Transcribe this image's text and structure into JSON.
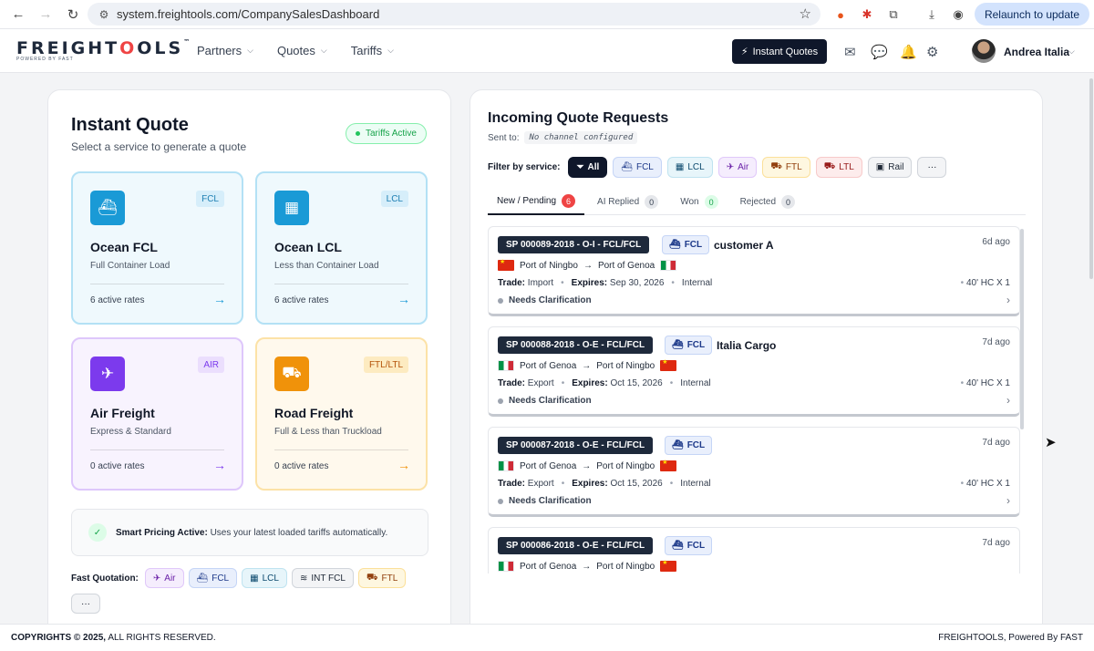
{
  "browser": {
    "url": "system.freightools.com/CompanySalesDashboard",
    "relaunch_label": "Relaunch to update"
  },
  "header": {
    "logo_text": "FREIGHTOOLS",
    "logo_tm": "™",
    "logo_sub": "POWERED BY FAST",
    "nav": [
      "Partners",
      "Quotes",
      "Tariffs"
    ],
    "instant_quotes_label": "Instant Quotes",
    "user_name": "Andrea Italia"
  },
  "instant_quote": {
    "title": "Instant Quote",
    "subtitle": "Select a service to generate a quote",
    "status_badge": "Tariffs Active",
    "services": [
      {
        "name": "Ocean FCL",
        "tag": "FCL",
        "desc": "Full Container Load",
        "rates": "6 active rates"
      },
      {
        "name": "Ocean LCL",
        "tag": "LCL",
        "desc": "Less than Container Load",
        "rates": "6 active rates"
      },
      {
        "name": "Air Freight",
        "tag": "AIR",
        "desc": "Express & Standard",
        "rates": "0 active rates"
      },
      {
        "name": "Road Freight",
        "tag": "FTL/LTL",
        "desc": "Full & Less than Truckload",
        "rates": "0 active rates"
      }
    ],
    "smart_pricing_title": "Smart Pricing Active:",
    "smart_pricing_text": "Uses your latest loaded tariffs automatically.",
    "fast_quotation_label": "Fast Quotation:",
    "fast_chips": [
      "Air",
      "FCL",
      "LCL",
      "INT FCL",
      "FTL"
    ],
    "more_label": "···"
  },
  "requests": {
    "title": "Incoming Quote Requests",
    "sent_to_label": "Sent to:",
    "sent_to_value": "No channel configured",
    "filter_label": "Filter by service:",
    "filters": [
      "All",
      "FCL",
      "LCL",
      "Air",
      "FTL",
      "LTL",
      "Rail"
    ],
    "filter_more": "···",
    "tabs": [
      {
        "label": "New / Pending",
        "count": "6"
      },
      {
        "label": "AI Replied",
        "count": "0"
      },
      {
        "label": "Won",
        "count": "0"
      },
      {
        "label": "Rejected",
        "count": "0"
      }
    ],
    "items": [
      {
        "ref": "SP 000089-2018 - O-I - FCL/FCL",
        "mode": "FCL",
        "customer": "customer A",
        "ago": "6d ago",
        "from": "Port of Ningbo",
        "to": "Port of Genoa",
        "trade_label": "Trade:",
        "trade": "Import",
        "expires_label": "Expires:",
        "expires": "Sep 30, 2026",
        "scope": "Internal",
        "container": "40' HC X 1",
        "status": "Needs Clarification"
      },
      {
        "ref": "SP 000088-2018 - O-E - FCL/FCL",
        "mode": "FCL",
        "customer": "Italia Cargo",
        "ago": "7d ago",
        "from": "Port of Genoa",
        "to": "Port of Ningbo",
        "trade_label": "Trade:",
        "trade": "Export",
        "expires_label": "Expires:",
        "expires": "Oct 15, 2026",
        "scope": "Internal",
        "container": "40' HC X 1",
        "status": "Needs Clarification"
      },
      {
        "ref": "SP 000087-2018 - O-E - FCL/FCL",
        "mode": "FCL",
        "customer": "",
        "ago": "7d ago",
        "from": "Port of Genoa",
        "to": "Port of Ningbo",
        "trade_label": "Trade:",
        "trade": "Export",
        "expires_label": "Expires:",
        "expires": "Oct 15, 2026",
        "scope": "Internal",
        "container": "40' HC X 1",
        "status": "Needs Clarification"
      },
      {
        "ref": "SP 000086-2018 - O-E - FCL/FCL",
        "mode": "FCL",
        "customer": "",
        "ago": "7d ago",
        "from": "Port of Genoa",
        "to": "Port of Ningbo"
      }
    ]
  },
  "footer": {
    "copyright_bold": "COPYRIGHTS © 2025,",
    "copyright_rest": "ALL RIGHTS RESERVED.",
    "right": "FREIGHTOOLS, Powered By FAST"
  },
  "colors": {
    "fcl": "#1a9ad6",
    "air": "#7c3aed",
    "road": "#f0920a",
    "dark": "#0f172a"
  }
}
